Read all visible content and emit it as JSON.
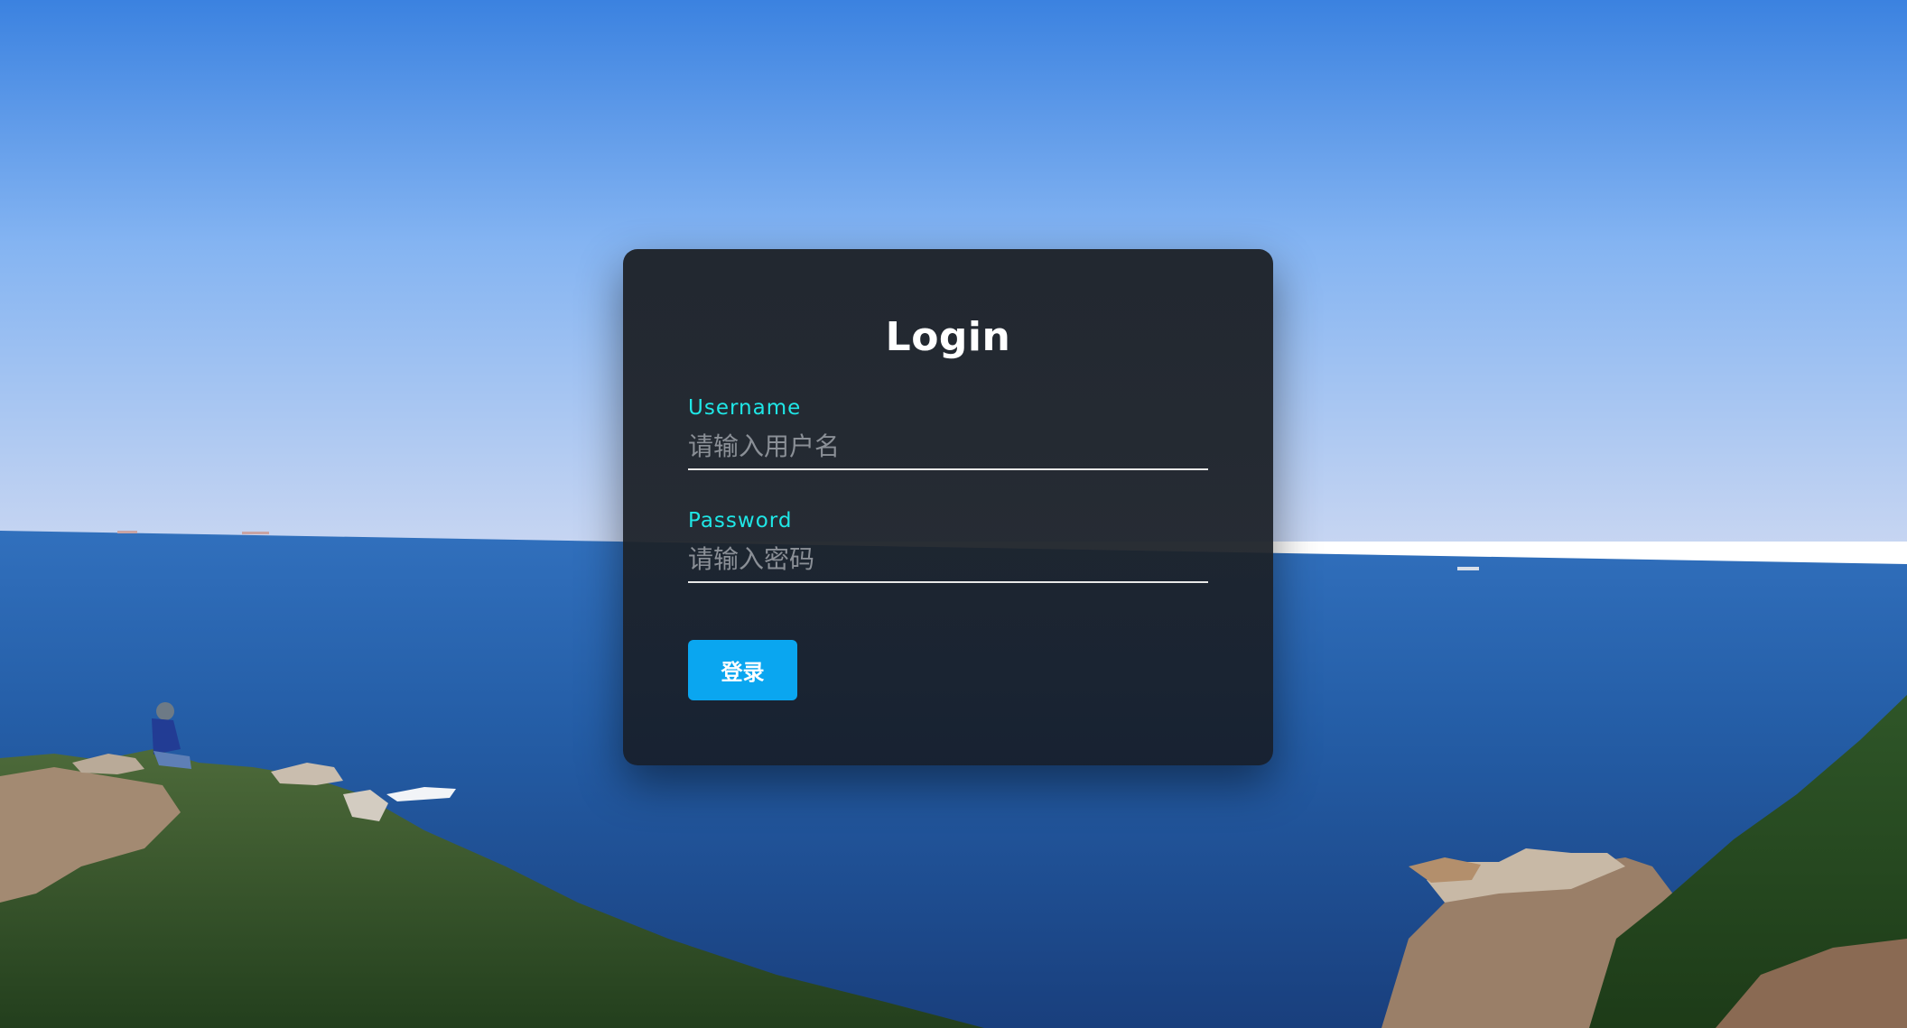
{
  "background": {
    "scene": "coastal-sea-landscape",
    "colors": {
      "sky_top": "#3d83df",
      "sky_horizon": "#c3d3f3",
      "sea_far": "#2b6cb8",
      "sea_near": "#1b4d8f",
      "hill_green": "#2f5a2a",
      "rock": "#a88f78"
    }
  },
  "login": {
    "title": "Login",
    "username": {
      "label": "Username",
      "placeholder": "请输入用户名",
      "value": ""
    },
    "password": {
      "label": "Password",
      "placeholder": "请输入密码",
      "value": ""
    },
    "submit_label": "登录"
  },
  "colors": {
    "label_accent": "#1fe6e6",
    "button": "#0aa6f0",
    "card": "#1e2228"
  }
}
